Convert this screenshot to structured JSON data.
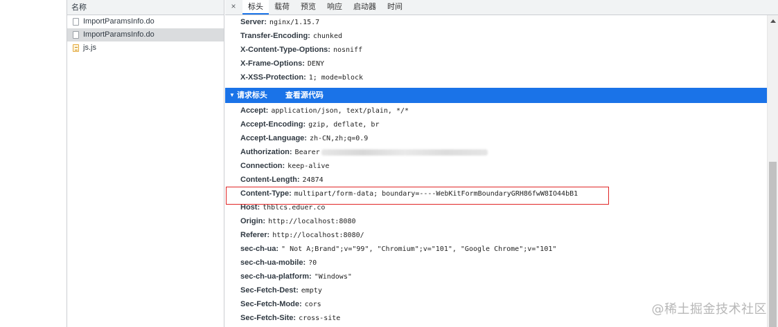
{
  "file_list": {
    "column_header": "名称",
    "files": [
      {
        "name": "ImportParamsInfo.do",
        "type": "doc",
        "selected": false
      },
      {
        "name": "ImportParamsInfo.do",
        "type": "doc",
        "selected": true
      },
      {
        "name": "js.js",
        "type": "script",
        "selected": false
      }
    ]
  },
  "tabs": {
    "close_icon": "×",
    "items": [
      "标头",
      "载荷",
      "预览",
      "响应",
      "启动器",
      "时间"
    ],
    "active": "标头"
  },
  "response_headers": [
    {
      "name": "Server:",
      "value": "nginx/1.15.7"
    },
    {
      "name": "Transfer-Encoding:",
      "value": "chunked"
    },
    {
      "name": "X-Content-Type-Options:",
      "value": "nosniff"
    },
    {
      "name": "X-Frame-Options:",
      "value": "DENY"
    },
    {
      "name": "X-XSS-Protection:",
      "value": "1; mode=block"
    }
  ],
  "request_section": {
    "title": "请求标头",
    "view_source": "查看源代码",
    "expanded_icon": "triangle-down-icon"
  },
  "request_headers": [
    {
      "name": "Accept:",
      "value": "application/json, text/plain, */*"
    },
    {
      "name": "Accept-Encoding:",
      "value": "gzip, deflate, br"
    },
    {
      "name": "Accept-Language:",
      "value": "zh-CN,zh;q=0.9"
    },
    {
      "name": "Authorization:",
      "value": "Bearer",
      "blurred": true
    },
    {
      "name": "Connection:",
      "value": "keep-alive"
    },
    {
      "name": "Content-Length:",
      "value": "24874"
    },
    {
      "name": "Content-Type:",
      "value": "multipart/form-data; boundary=----WebKitFormBoundaryGRH86fwW8IO44bB1",
      "highlighted": true
    },
    {
      "name": "Host:",
      "value": "thblcs.eduer.co"
    },
    {
      "name": "Origin:",
      "value": "http://localhost:8080"
    },
    {
      "name": "Referer:",
      "value": "http://localhost:8080/"
    },
    {
      "name": "sec-ch-ua:",
      "value": "\" Not A;Brand\";v=\"99\", \"Chromium\";v=\"101\", \"Google Chrome\";v=\"101\""
    },
    {
      "name": "sec-ch-ua-mobile:",
      "value": "?0"
    },
    {
      "name": "sec-ch-ua-platform:",
      "value": "\"Windows\""
    },
    {
      "name": "Sec-Fetch-Dest:",
      "value": "empty"
    },
    {
      "name": "Sec-Fetch-Mode:",
      "value": "cors"
    },
    {
      "name": "Sec-Fetch-Site:",
      "value": "cross-site"
    }
  ],
  "watermark": "@稀土掘金技术社区",
  "colors": {
    "section_bg": "#1a73e8",
    "highlight_border": "#e02424",
    "selected_row": "#dadcde"
  }
}
